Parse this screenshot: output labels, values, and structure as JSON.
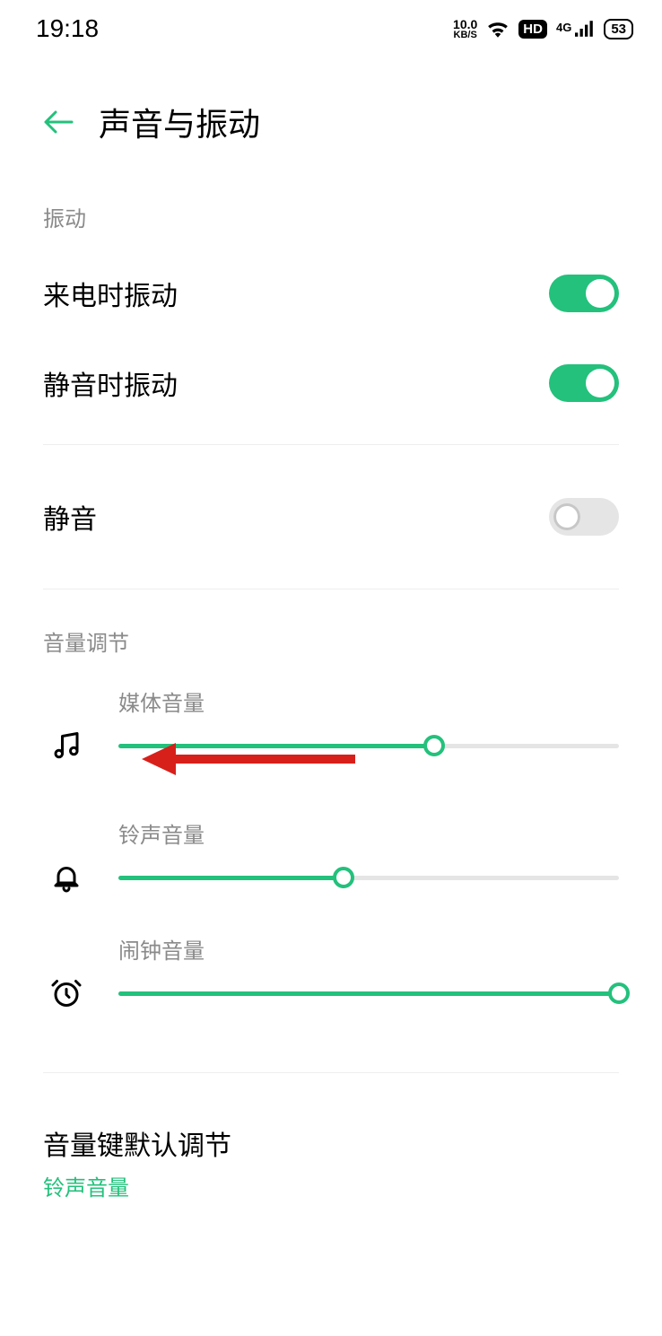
{
  "status": {
    "time": "19:18",
    "net_speed_top": "10.0",
    "net_speed_unit": "KB/S",
    "hd": "HD",
    "net_type": "4G",
    "battery": "53"
  },
  "header": {
    "title": "声音与振动"
  },
  "sections": {
    "vibration_label": "振动",
    "volume_label": "音量调节"
  },
  "toggles": {
    "vibrate_on_ring": {
      "label": "来电时振动",
      "on": true
    },
    "vibrate_on_silent": {
      "label": "静音时振动",
      "on": true
    },
    "silent_mode": {
      "label": "静音",
      "on": false
    }
  },
  "sliders": {
    "media": {
      "label": "媒体音量",
      "value": 63
    },
    "ring": {
      "label": "铃声音量",
      "value": 45
    },
    "alarm": {
      "label": "闹钟音量",
      "value": 100
    }
  },
  "volume_key": {
    "label": "音量键默认调节",
    "value": "铃声音量"
  }
}
